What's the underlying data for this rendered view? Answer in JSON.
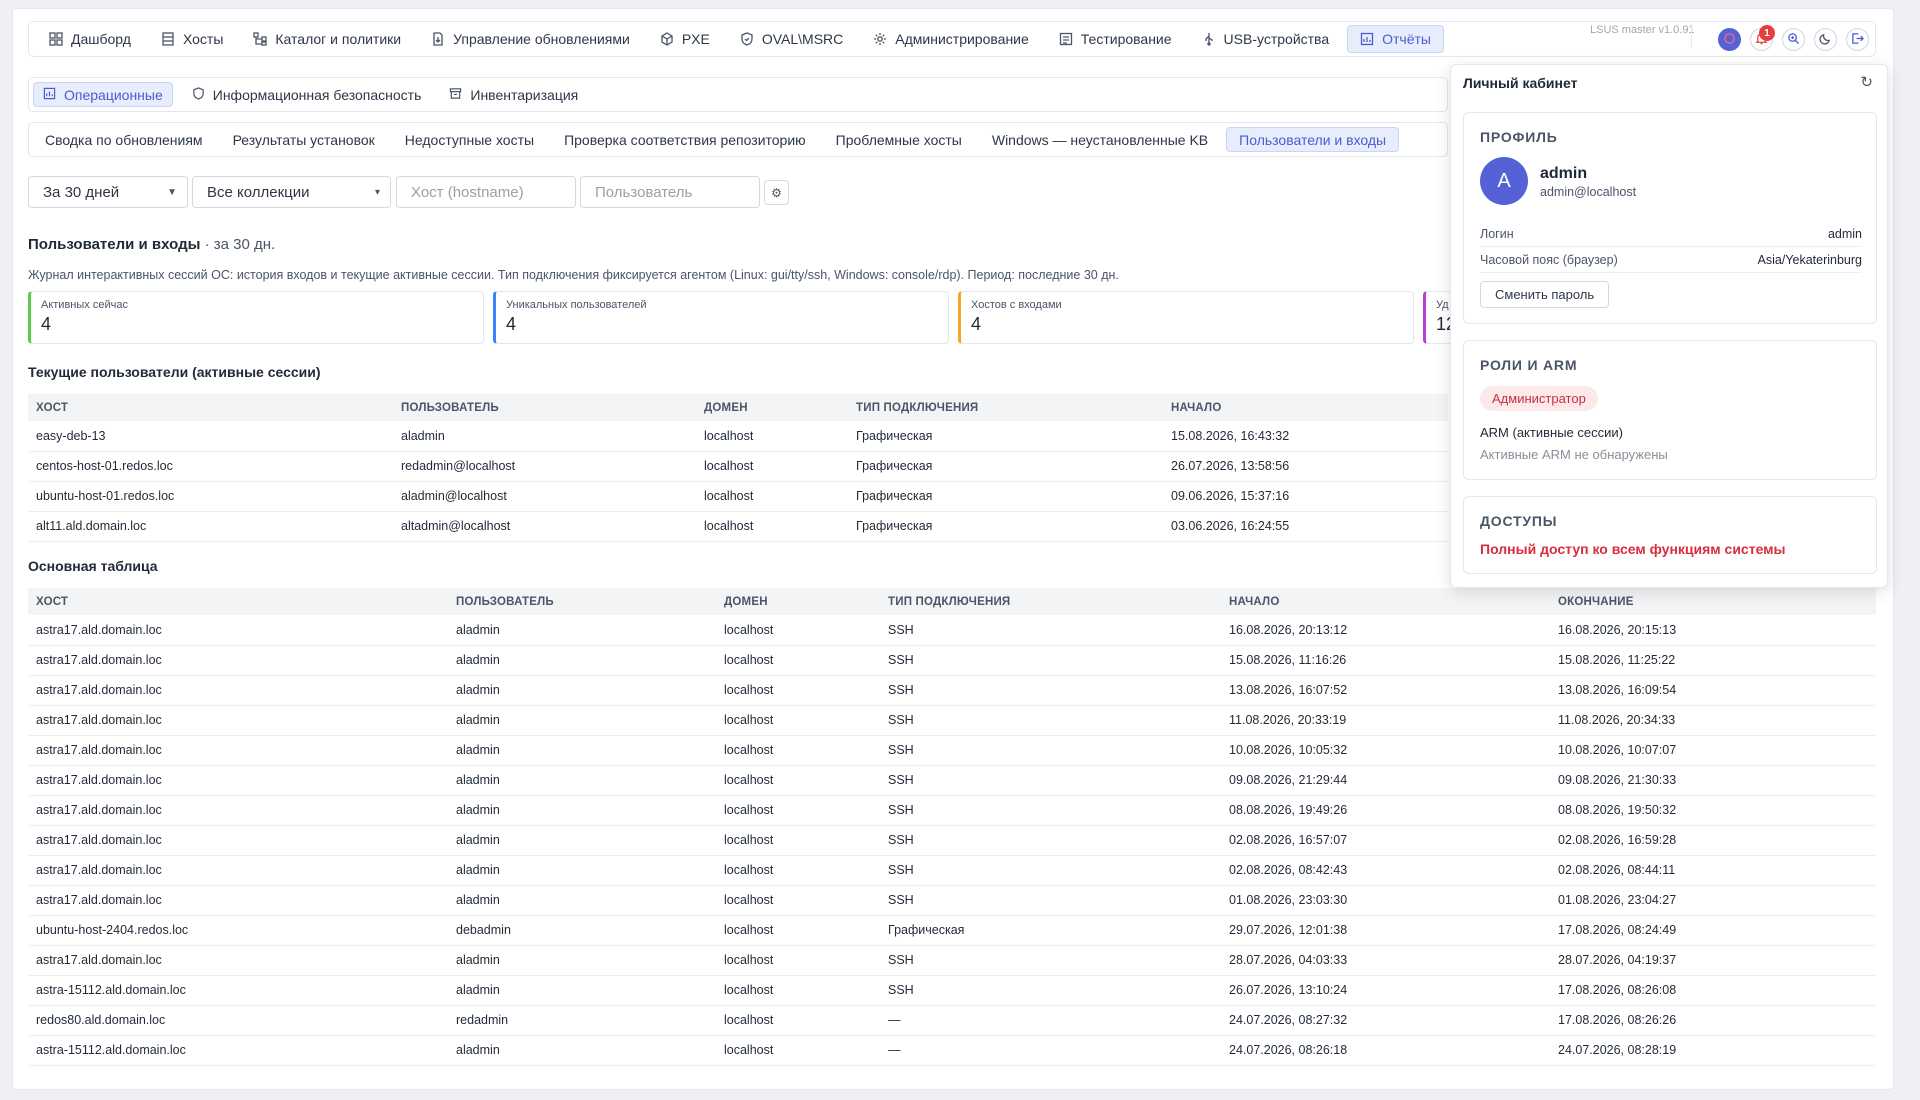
{
  "nav": {
    "items": [
      {
        "label": "Дашборд"
      },
      {
        "label": "Хосты"
      },
      {
        "label": "Каталог и политики"
      },
      {
        "label": "Управление обновлениями"
      },
      {
        "label": "PXE"
      },
      {
        "label": "OVAL\\MSRC"
      },
      {
        "label": "Администрирование"
      },
      {
        "label": "Тестирование"
      },
      {
        "label": "USB-устройства"
      },
      {
        "label": "Отчёты"
      }
    ],
    "version": "LSUS master v1.0.91",
    "notifications_count": "1"
  },
  "subnav": {
    "items": [
      {
        "label": "Операционные"
      },
      {
        "label": "Информационная безопасность"
      },
      {
        "label": "Инвентаризация"
      }
    ]
  },
  "reports": {
    "items": [
      {
        "label": "Сводка по обновлениям"
      },
      {
        "label": "Результаты установок"
      },
      {
        "label": "Недоступные хосты"
      },
      {
        "label": "Проверка соответствия репозиторию"
      },
      {
        "label": "Проблемные хосты"
      },
      {
        "label": "Windows — неустановленные KB"
      },
      {
        "label": "Пользователи и входы"
      }
    ]
  },
  "filters": {
    "period": "За 30 дней",
    "collection": "Все коллекции",
    "host_placeholder": "Хост (hostname)",
    "user_placeholder": "Пользователь"
  },
  "page": {
    "title": "Пользователи и входы",
    "title_suffix": " · за 30 дн.",
    "description": "Журнал интерактивных сессий ОС: история входов и текущие активные сессии. Тип подключения фиксируется агентом (Linux: gui/tty/ssh, Windows: console/rdp). Период: последние 30 дн."
  },
  "stats": [
    {
      "label": "Активных сейчас",
      "value": "4",
      "color": "#5cc94a"
    },
    {
      "label": "Уникальных пользователей",
      "value": "4",
      "color": "#3b82f6"
    },
    {
      "label": "Хостов с входами",
      "value": "4",
      "color": "#f5a623"
    },
    {
      "label": "Уд",
      "value": "12",
      "color": "#b83fd6"
    }
  ],
  "active": {
    "title": "Текущие пользователи (активные сессии)",
    "headers": [
      "ХОСТ",
      "ПОЛЬЗОВАТЕЛЬ",
      "ДОМЕН",
      "ТИП ПОДКЛЮЧЕНИЯ",
      "НАЧАЛО"
    ],
    "rows": [
      [
        "easy-deb-13",
        "aladmin",
        "localhost",
        "Графическая",
        "15.08.2026, 16:43:32"
      ],
      [
        "centos-host-01.redos.loc",
        "redadmin@localhost",
        "localhost",
        "Графическая",
        "26.07.2026, 13:58:56"
      ],
      [
        "ubuntu-host-01.redos.loc",
        "aladmin@localhost",
        "localhost",
        "Графическая",
        "09.06.2026, 15:37:16"
      ],
      [
        "alt11.ald.domain.loc",
        "altadmin@localhost",
        "localhost",
        "Графическая",
        "03.06.2026, 16:24:55"
      ]
    ]
  },
  "main": {
    "title": "Основная таблица",
    "headers": [
      "ХОСТ",
      "ПОЛЬЗОВАТЕЛЬ",
      "ДОМЕН",
      "ТИП ПОДКЛЮЧЕНИЯ",
      "НАЧАЛО",
      "ОКОНЧАНИЕ"
    ],
    "rows": [
      [
        "astra17.ald.domain.loc",
        "aladmin",
        "localhost",
        "SSH",
        "16.08.2026, 20:13:12",
        "16.08.2026, 20:15:13"
      ],
      [
        "astra17.ald.domain.loc",
        "aladmin",
        "localhost",
        "SSH",
        "15.08.2026, 11:16:26",
        "15.08.2026, 11:25:22"
      ],
      [
        "astra17.ald.domain.loc",
        "aladmin",
        "localhost",
        "SSH",
        "13.08.2026, 16:07:52",
        "13.08.2026, 16:09:54"
      ],
      [
        "astra17.ald.domain.loc",
        "aladmin",
        "localhost",
        "SSH",
        "11.08.2026, 20:33:19",
        "11.08.2026, 20:34:33"
      ],
      [
        "astra17.ald.domain.loc",
        "aladmin",
        "localhost",
        "SSH",
        "10.08.2026, 10:05:32",
        "10.08.2026, 10:07:07"
      ],
      [
        "astra17.ald.domain.loc",
        "aladmin",
        "localhost",
        "SSH",
        "09.08.2026, 21:29:44",
        "09.08.2026, 21:30:33"
      ],
      [
        "astra17.ald.domain.loc",
        "aladmin",
        "localhost",
        "SSH",
        "08.08.2026, 19:49:26",
        "08.08.2026, 19:50:32"
      ],
      [
        "astra17.ald.domain.loc",
        "aladmin",
        "localhost",
        "SSH",
        "02.08.2026, 16:57:07",
        "02.08.2026, 16:59:28"
      ],
      [
        "astra17.ald.domain.loc",
        "aladmin",
        "localhost",
        "SSH",
        "02.08.2026, 08:42:43",
        "02.08.2026, 08:44:11"
      ],
      [
        "astra17.ald.domain.loc",
        "aladmin",
        "localhost",
        "SSH",
        "01.08.2026, 23:03:30",
        "01.08.2026, 23:04:27"
      ],
      [
        "ubuntu-host-2404.redos.loc",
        "debadmin",
        "localhost",
        "Графическая",
        "29.07.2026, 12:01:38",
        "17.08.2026, 08:24:49"
      ],
      [
        "astra17.ald.domain.loc",
        "aladmin",
        "localhost",
        "SSH",
        "28.07.2026, 04:03:33",
        "28.07.2026, 04:19:37"
      ],
      [
        "astra-15112.ald.domain.loc",
        "aladmin",
        "localhost",
        "SSH",
        "26.07.2026, 13:10:24",
        "17.08.2026, 08:26:08"
      ],
      [
        "redos80.ald.domain.loc",
        "redadmin",
        "localhost",
        "—",
        "24.07.2026, 08:27:32",
        "17.08.2026, 08:26:26"
      ],
      [
        "astra-15112.ald.domain.loc",
        "aladmin",
        "localhost",
        "—",
        "24.07.2026, 08:26:18",
        "24.07.2026, 08:28:19"
      ]
    ]
  },
  "profile": {
    "header": "Личный кабинет",
    "profile_title": "ПРОФИЛЬ",
    "avatar_letter": "A",
    "name": "admin",
    "email": "admin@localhost",
    "login_label": "Логин",
    "login_value": "admin",
    "tz_label": "Часовой пояс (браузер)",
    "tz_value": "Asia/Yekaterinburg",
    "change_password": "Сменить пароль",
    "roles_title": "РОЛИ И ARM",
    "role": "Администратор",
    "arm_title": "ARM (активные сессии)",
    "arm_empty": "Активные ARM не обнаружены",
    "access_title": "ДОСТУПЫ",
    "access_text": "Полный доступ ко всем функциям системы"
  }
}
